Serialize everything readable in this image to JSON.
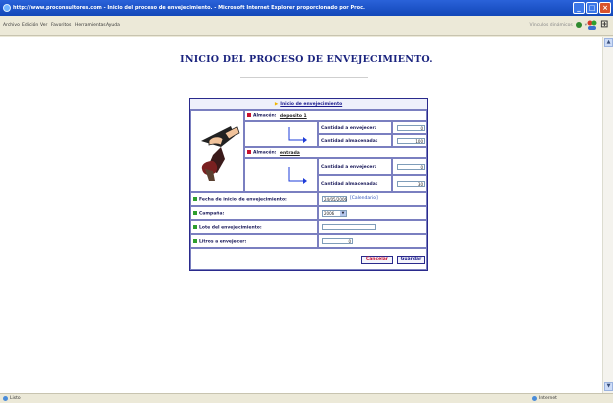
{
  "window": {
    "title": "http://www.proconsultores.com - Inicio del proceso de envejecimiento. - Microsoft Internet Explorer proporcionado por Proc."
  },
  "menubar": {
    "items": [
      "Archivo",
      "Edición",
      "Ver",
      "Favoritos",
      "Herramientas",
      "Ayuda"
    ],
    "links_label": "Vínculos dinámicos"
  },
  "page": {
    "title": "INICIO DEL PROCESO DE ENVEJECIMIENTO."
  },
  "form": {
    "header_link": "Inicio de envejecimiento",
    "almacen_label": "Almacén:",
    "deposito_value": "deposito 1",
    "entrada_value": "entrada",
    "cantidad_envejecer_label": "Cantidad a envejecer:",
    "cantidad_almacenada_label": "Cantidad almacenada:",
    "deposito": {
      "cantidad_envejecer": "0",
      "cantidad_almacenada": "100"
    },
    "entrada": {
      "cantidad_envejecer": "0",
      "cantidad_almacenada": "30"
    },
    "fecha_label": "Fecha de inicio de envejecimiento:",
    "fecha_value": "24/05/2006",
    "calendar_link": "[Calendario]",
    "campana_label": "Campaña:",
    "campana_value": "2006",
    "lote_label": "Lote del envejecimiento:",
    "lote_value": "",
    "litros_label": "Litros a envejecer:",
    "litros_value": "0",
    "cancel_label": "Cancelar",
    "save_label": "Guardar"
  },
  "status": {
    "left": "Listo",
    "zone": "Internet"
  }
}
